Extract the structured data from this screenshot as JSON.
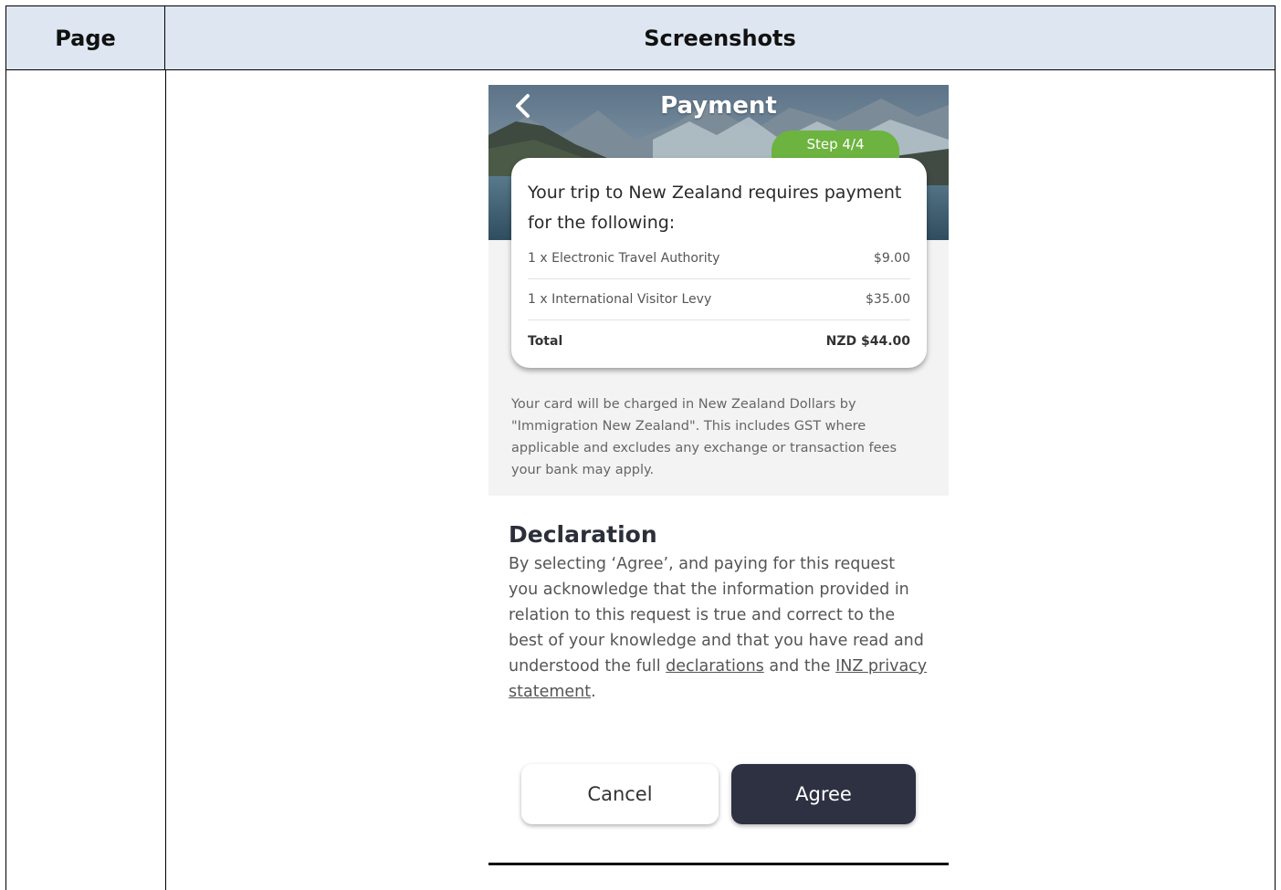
{
  "table": {
    "col_page_header": "Page",
    "col_screenshots_header": "Screenshots"
  },
  "app": {
    "title": "Payment",
    "back_icon": "chevron-left-icon",
    "step": "Step 4/4",
    "colors": {
      "step_green": "#6db33f",
      "agree_button": "#2d3142",
      "card_bg": "#ffffff",
      "band_bg": "#f3f3f3"
    }
  },
  "summary": {
    "intro": "Your trip to New Zealand requires payment for the following:",
    "items": [
      {
        "label": "1 x Electronic Travel Authority",
        "amount": "$9.00"
      },
      {
        "label": "1 x International Visitor Levy",
        "amount": "$35.00"
      }
    ],
    "total_label": "Total",
    "total_amount": "NZD $44.00"
  },
  "charge_note": "Your card will be charged in New Zealand Dollars by \"Immigration New Zealand\". This includes GST where applicable and excludes any exchange or transaction fees your bank may apply.",
  "declaration": {
    "title": "Declaration",
    "text_before": "By selecting ‘Agree’, and paying for this request you acknowledge that the information provided in relation to this request is true and correct to the best of your knowledge and that you have read and understood the full ",
    "link_declarations": "declarations",
    "text_middle": " and the ",
    "link_privacy": "INZ privacy statement",
    "text_after": "."
  },
  "buttons": {
    "cancel": "Cancel",
    "agree": "Agree"
  }
}
